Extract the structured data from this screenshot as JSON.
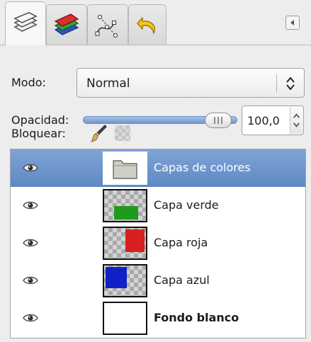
{
  "tabs": [
    {
      "icon": "layers-icon",
      "active": true
    },
    {
      "icon": "channels-icon",
      "active": false
    },
    {
      "icon": "paths-icon",
      "active": false
    },
    {
      "icon": "undo-history-icon",
      "active": false
    }
  ],
  "tab_menu_icon": "tab-menu-arrow-icon",
  "mode": {
    "label": "Modo:",
    "value": "Normal"
  },
  "opacity": {
    "label": "Opacidad:",
    "value": "100,0",
    "percent": 100
  },
  "lock": {
    "label": "Bloquear:",
    "icons": [
      "paintbrush-lock-icon",
      "alpha-lock-icon"
    ]
  },
  "layers": [
    {
      "name": "Capas de colores",
      "selected": true,
      "thumb": "folder",
      "bold": false,
      "visible": true
    },
    {
      "name": "Capa verde",
      "selected": false,
      "thumb": "green",
      "bold": false,
      "visible": true
    },
    {
      "name": "Capa roja",
      "selected": false,
      "thumb": "red",
      "bold": false,
      "visible": true
    },
    {
      "name": "Capa azul",
      "selected": false,
      "thumb": "blue",
      "bold": false,
      "visible": true
    },
    {
      "name": "Fondo blanco",
      "selected": false,
      "thumb": "white",
      "bold": true,
      "visible": true
    }
  ],
  "colors": {
    "selection": "#6a93cb",
    "green": "#1f9a1f",
    "red": "#d81e1e",
    "blue": "#1020c8"
  }
}
